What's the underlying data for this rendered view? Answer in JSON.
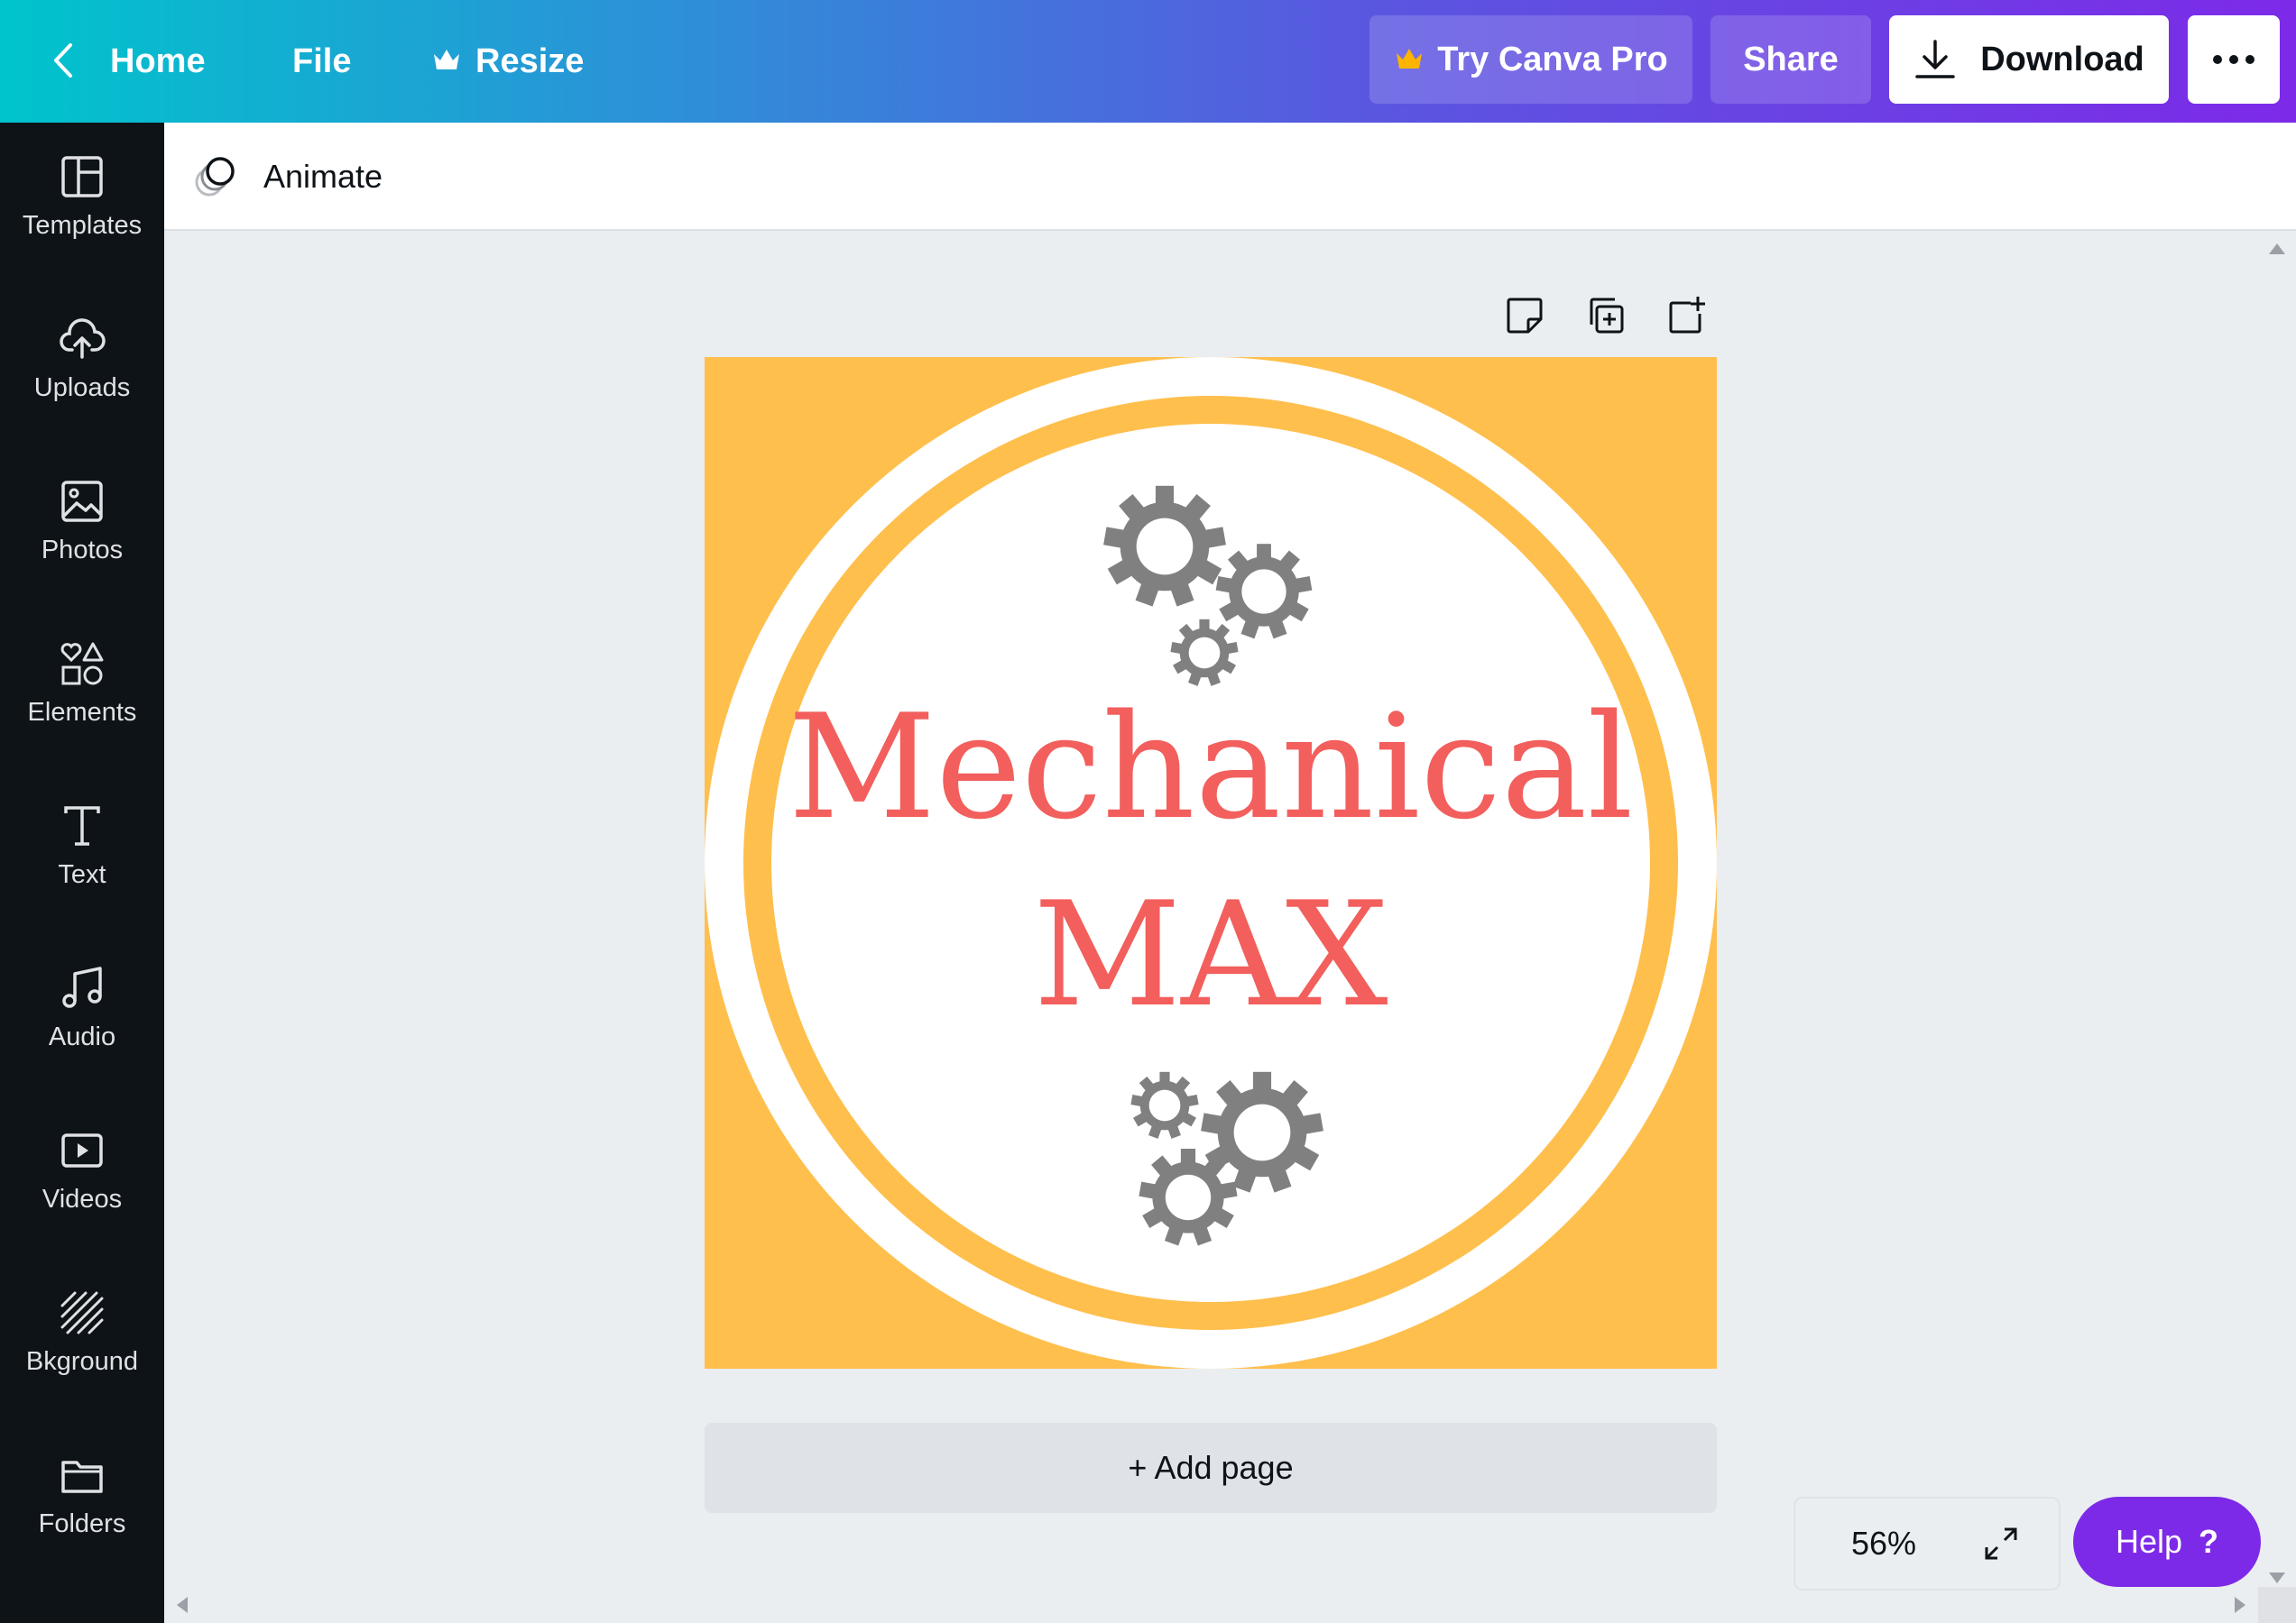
{
  "topbar": {
    "home_label": "Home",
    "file_label": "File",
    "resize_label": "Resize",
    "try_pro_label": "Try Canva Pro",
    "share_label": "Share",
    "download_label": "Download",
    "more_icon": "more-dots-icon",
    "colors": {
      "gradient_start": "#00c4cc",
      "gradient_end": "#7d2ae8",
      "crown": "#ffb400"
    }
  },
  "sidebar": {
    "items": [
      {
        "label": "Templates",
        "icon": "templates-icon"
      },
      {
        "label": "Uploads",
        "icon": "upload-cloud-icon"
      },
      {
        "label": "Photos",
        "icon": "photo-icon"
      },
      {
        "label": "Elements",
        "icon": "shapes-icon"
      },
      {
        "label": "Text",
        "icon": "text-icon"
      },
      {
        "label": "Audio",
        "icon": "music-note-icon"
      },
      {
        "label": "Videos",
        "icon": "video-icon"
      },
      {
        "label": "Bkground",
        "icon": "background-pattern-icon"
      },
      {
        "label": "Folders",
        "icon": "folder-icon"
      }
    ]
  },
  "toolbar": {
    "animate_label": "Animate"
  },
  "design": {
    "title_line1": "Mechanical",
    "title_line2": "MAX",
    "colors": {
      "background": "#ffbf4d",
      "ring": "#ffffff",
      "text": "#f25f5c",
      "gears": "#808080"
    }
  },
  "canvas": {
    "add_page_label": "+ Add page",
    "zoom_label": "56%",
    "help_label": "Help",
    "help_glyph": "?"
  }
}
